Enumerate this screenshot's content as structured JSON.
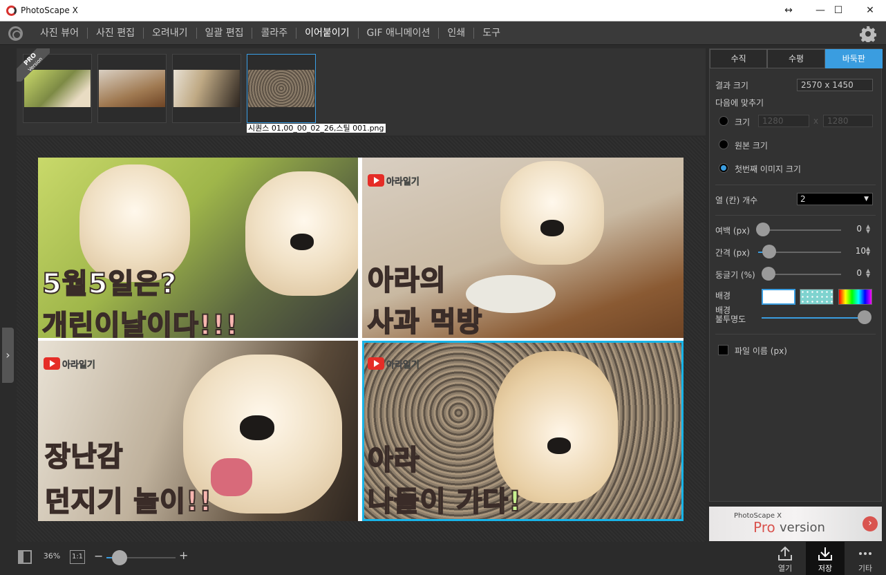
{
  "app": {
    "title": "PhotoScape X"
  },
  "menu": {
    "items": [
      {
        "label": "사진 뷰어"
      },
      {
        "label": "사진 편집"
      },
      {
        "label": "오려내기"
      },
      {
        "label": "일괄 편집"
      },
      {
        "label": "콜라주"
      },
      {
        "label": "이어붙이기"
      },
      {
        "label": "GIF 애니메이션"
      },
      {
        "label": "인쇄"
      },
      {
        "label": "도구"
      }
    ],
    "active_label": "이어붙이기"
  },
  "badge": {
    "pro": "PRO",
    "sub": "Version"
  },
  "thumbnails": {
    "count": 4,
    "selected_index": 3,
    "selected_caption": "시퀀스 01,00_00_02_26,스틸 001.png"
  },
  "collage": {
    "cells": [
      {
        "line1": "5월5일은?",
        "line2": "개린이날이다!!!",
        "line2_color": "#f7b6b0"
      },
      {
        "line1": "아라의",
        "line2": "사과 먹방",
        "line2_color": "#f8e27a"
      },
      {
        "line1": "장난감",
        "line2": "던지기 놀이!!",
        "line2_color": "#f7b6b0"
      },
      {
        "line1": "아라",
        "line2": "나들이 가다!",
        "line2_color": "#c7f08f"
      }
    ],
    "watermark_brand": "아라",
    "watermark_suffix": "일기",
    "selected_border_color": "#18b4e8"
  },
  "panel": {
    "tabs": [
      {
        "label": "수직"
      },
      {
        "label": "수평"
      },
      {
        "label": "바둑판"
      }
    ],
    "active_tab": "바둑판",
    "result_size_label": "결과 크기",
    "result_size_value": "2570 x 1450",
    "fit_label": "다음에 맞추기",
    "size_option_label": "크기",
    "size_w": "1280",
    "size_h": "1280",
    "size_times": "x",
    "original_size_label": "원본 크기",
    "first_image_size_label": "첫번째 이미지 크기",
    "columns_label": "열 (칸) 개수",
    "columns_value": "2",
    "margin_label": "여백 (px)",
    "margin_value": "0",
    "spacing_label": "간격 (px)",
    "spacing_value": "10",
    "roundness_label": "둥글기 (%)",
    "roundness_value": "0",
    "background_label": "배경",
    "bg_opacity_label_1": "배경",
    "bg_opacity_label_2": "불투명도",
    "bg_opacity_value": 1.0,
    "filename_label": "파일 이름 (px)",
    "filename_checked": false
  },
  "ad": {
    "brand": "PhotoScape X",
    "pro": "Pro",
    "version": "version"
  },
  "bottom": {
    "zoom": "36%",
    "one_to_one": "1:1",
    "zoom_minus": "−",
    "zoom_plus": "+",
    "zoom_fraction": 0.12,
    "open_label": "열기",
    "save_label": "저장",
    "more_label": "기타"
  },
  "colors": {
    "accent": "#3a9de0",
    "brand_red": "#d8322f"
  }
}
